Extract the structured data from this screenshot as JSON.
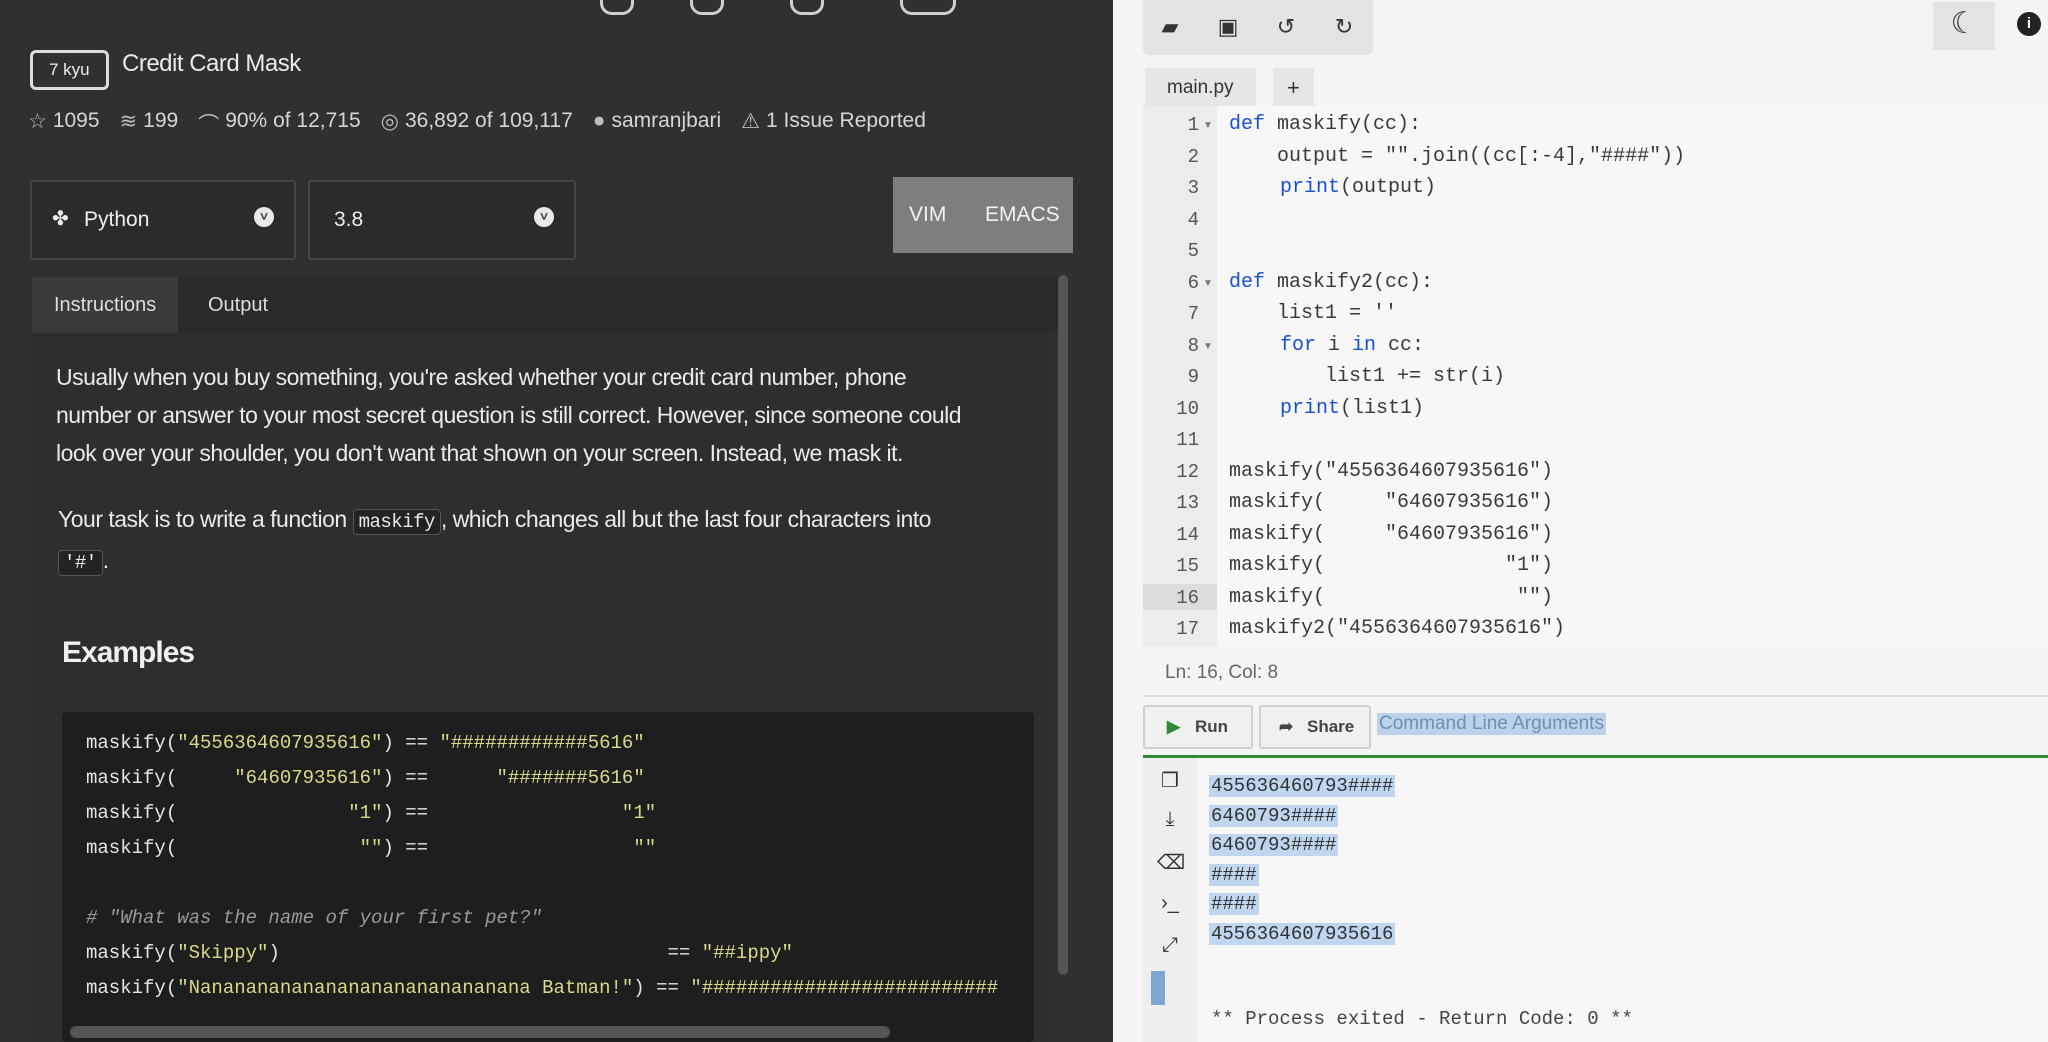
{
  "kata": {
    "rank": "7 kyu",
    "title": "Credit Card Mask",
    "stats": {
      "stars": "1095",
      "collections": "199",
      "satisfaction": "90% of 12,715",
      "completed": "36,892 of 109,117",
      "author": "samranjbari",
      "issues": "1 Issue Reported"
    }
  },
  "language": {
    "selected": "Python",
    "version": "3.8"
  },
  "modes": {
    "vim": "VIM",
    "emacs": "EMACS"
  },
  "tabs": {
    "instructions": "Instructions",
    "output": "Output"
  },
  "instructions": {
    "para1_line1": "Usually when you buy something, you're asked whether your credit card number, phone",
    "para1_line2": "number or answer to your most secret question is still correct. However, since someone could",
    "para1_line3": "look over your shoulder, you don't want that shown on your screen. Instead, we mask it.",
    "para2_pre": "Your task is to write a function ",
    "para2_code": "maskify",
    "para2_post": ", which changes all but the last four characters into",
    "para2_code2": "'#'",
    "para2_end": ".",
    "examples_heading": "Examples"
  },
  "examples": {
    "l1a": "maskify(",
    "l1s": "\"4556364607935616\"",
    "l1b": ") == ",
    "l1r": "\"############5616\"",
    "l2a": "maskify(     ",
    "l2s": "\"64607935616\"",
    "l2b": ") == ",
    "l2r": "     \"#######5616\"",
    "l3a": "maskify(               ",
    "l3s": "\"1\"",
    "l3b": ") == ",
    "l3r": "                \"1\"",
    "l4a": "maskify(                ",
    "l4s": "\"\"",
    "l4b": ") == ",
    "l4r": "                 \"\"",
    "comment": "# \"What was the name of your first pet?\"",
    "l5a": "maskify(",
    "l5s": "\"Skippy\"",
    "l5b": ")                                  == ",
    "l5r": "\"##ippy\"",
    "l6a": "maskify(",
    "l6s": "\"Nanananananananananananananana Batman!\"",
    "l6b": ") == ",
    "l6r": "\"##########################"
  },
  "editor": {
    "file_tab": "main.py",
    "add_tab": "+",
    "line_numbers": [
      "1",
      "2",
      "3",
      "4",
      "5",
      "6",
      "7",
      "8",
      "9",
      "10",
      "11",
      "12",
      "13",
      "14",
      "15",
      "16",
      "17"
    ],
    "lines": {
      "l1_kw": "def",
      "l1_rest": " maskify(cc):",
      "l2": "    output = \"\".join((cc[:-4],\"####\"))",
      "l3_kw": "print",
      "l3_rest": "(output)",
      "l6_kw": "def",
      "l6_rest": " maskify2(cc):",
      "l7": "    list1 = ''",
      "l8_kw1": "for",
      "l8_mid": " i ",
      "l8_kw2": "in",
      "l8_rest": " cc:",
      "l9": "        list1 += str(i)",
      "l10_kw": "print",
      "l10_rest": "(list1)",
      "l12": "maskify(\"4556364607935616\")",
      "l13": "maskify(     \"64607935616\")",
      "l14": "maskify(     \"64607935616\")",
      "l15": "maskify(               \"1\")",
      "l16": "maskify(                \"\")",
      "l17": "maskify2(\"4556364607935616\")"
    },
    "status": "Ln: 16, Col: 8"
  },
  "actions": {
    "run": "Run",
    "share": "Share",
    "cla": "Command Line Arguments"
  },
  "console": {
    "out1": "455636460793####",
    "out2": "6460793####",
    "out3": "6460793####",
    "out4": "####",
    "out5": "####",
    "out6": "4556364607935616",
    "exit": "** Process exited - Return Code: 0 **"
  }
}
